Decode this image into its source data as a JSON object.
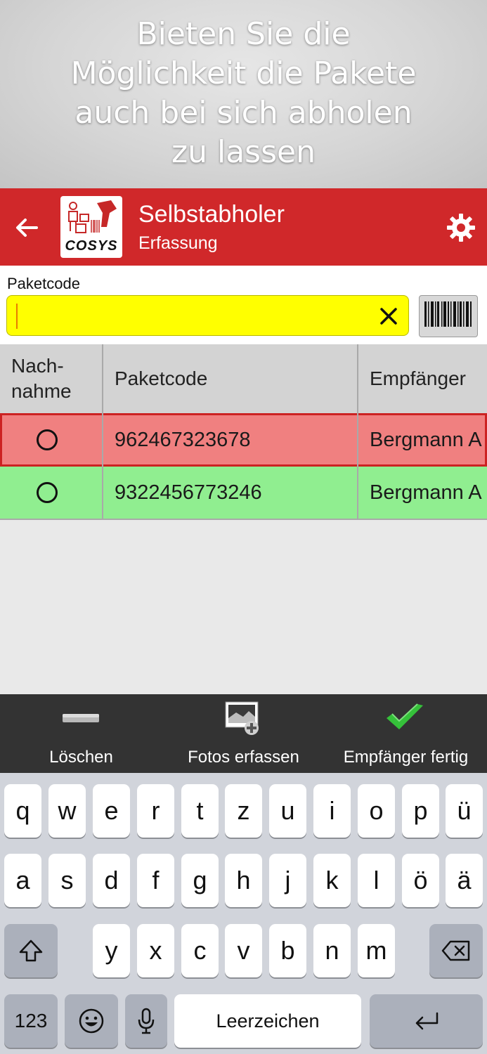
{
  "promo": {
    "text": "Bieten Sie die\nMöglichkeit die Pakete\nauch bei sich abholen\nzu lassen"
  },
  "appbar": {
    "title": "Selbstabholer",
    "subtitle": "Erfassung",
    "logo_text": "COSYS",
    "color": "#d0282a"
  },
  "search": {
    "label": "Paketcode",
    "value": "",
    "field_color": "#ffff00"
  },
  "table": {
    "headers": [
      "Nach-\nnahme",
      "Paketcode",
      "Empfänger"
    ],
    "rows": [
      {
        "nachnahme": "",
        "paketcode": "962467323678",
        "empfaenger": "Bergmann A",
        "state": "error",
        "bg": "#f08080"
      },
      {
        "nachnahme": "",
        "paketcode": "9322456773246",
        "empfaenger": "Bergmann A",
        "state": "ok",
        "bg": "#90ee90"
      }
    ]
  },
  "toolbar": {
    "delete_label": "Löschen",
    "photos_label": "Fotos erfassen",
    "done_label": "Empfänger fertig"
  },
  "keyboard": {
    "row1": [
      "q",
      "w",
      "e",
      "r",
      "t",
      "z",
      "u",
      "i",
      "o",
      "p",
      "ü"
    ],
    "row2": [
      "a",
      "s",
      "d",
      "f",
      "g",
      "h",
      "j",
      "k",
      "l",
      "ö",
      "ä"
    ],
    "row3": [
      "y",
      "x",
      "c",
      "v",
      "b",
      "n",
      "m"
    ],
    "numbers_label": "123",
    "space_label": "Leerzeichen"
  }
}
